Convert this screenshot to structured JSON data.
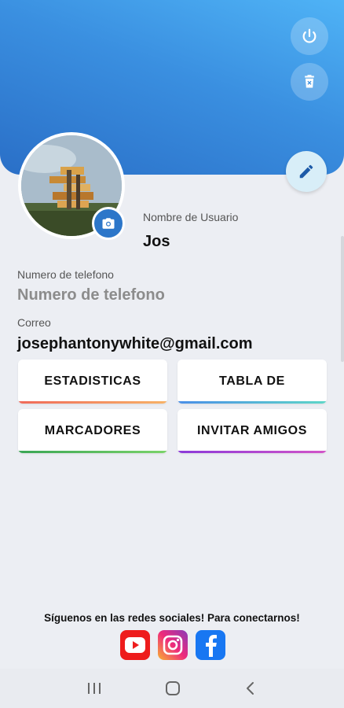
{
  "profile": {
    "username_label": "Nombre de Usuario",
    "username": "Jos",
    "phone_label": "Numero de telefono",
    "phone_value": "Numero de telefono",
    "email_label": "Correo",
    "email_value": "josephantonywhite@gmail.com"
  },
  "menu": {
    "stats": "ESTADISTICAS",
    "table": "TABLA DE",
    "scores": "MARCADORES",
    "invite": "INVITAR AMIGOS"
  },
  "social": {
    "text": "Síguenos en las redes sociales! Para conectarnos!",
    "icons": [
      "youtube-icon",
      "instagram-icon",
      "facebook-icon"
    ]
  },
  "colors": {
    "header_top": "#4fb3f6",
    "header_bottom": "#2a6fc7",
    "accent": "#2c76c9"
  }
}
